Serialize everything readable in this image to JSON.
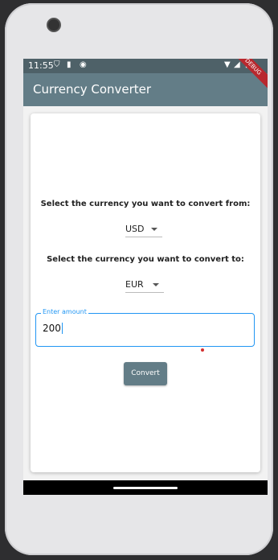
{
  "status": {
    "time": "11:55",
    "icons": [
      "shield-icon",
      "sim-icon",
      "data-saver-icon",
      "wifi-icon",
      "signal-icon",
      "battery-icon"
    ]
  },
  "app": {
    "title": "Currency Converter",
    "debug_banner": "DEBUG"
  },
  "form": {
    "from_label": "Select the currency you want to convert from:",
    "from_value": "USD",
    "to_label": "Select the currency you want to convert to:",
    "to_value": "EUR",
    "amount_label": "Enter amount",
    "amount_value": "200",
    "convert_label": "Convert"
  },
  "colors": {
    "appbar": "#637d87",
    "statusbar": "#4e6168",
    "accent": "#2196f3",
    "error": "#d32f2f"
  }
}
